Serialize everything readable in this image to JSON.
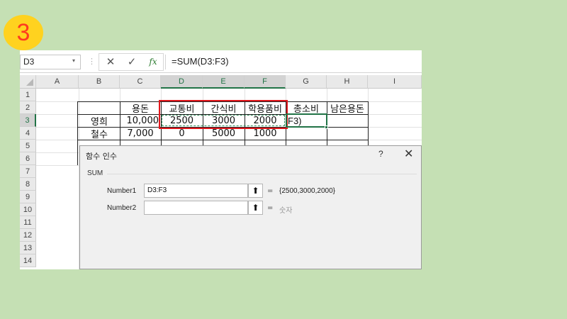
{
  "step_number": "3",
  "namebox": {
    "value": "D3",
    "dropdown_icon": "chevron-down-icon"
  },
  "formula_bar": {
    "cancel_icon": "close-icon",
    "enter_icon": "check-icon",
    "fx_label": "fx",
    "formula": "=SUM(D3:F3)"
  },
  "columns": [
    "A",
    "B",
    "C",
    "D",
    "E",
    "F",
    "G",
    "H",
    "I"
  ],
  "rows": [
    "1",
    "2",
    "3",
    "4",
    "5",
    "6",
    "7",
    "8",
    "9",
    "10",
    "11",
    "12",
    "13",
    "14"
  ],
  "sheet": {
    "header_row": [
      "용돈",
      "교통비",
      "간식비",
      "학용품비",
      "총소비",
      "남은용돈"
    ],
    "data_rows": [
      {
        "name": "영희",
        "values": [
          "10,000",
          "2500",
          "3000",
          "2000",
          "F3)",
          ""
        ]
      },
      {
        "name": "철수",
        "values": [
          "7,000",
          "0",
          "5000",
          "1000",
          "",
          ""
        ]
      }
    ]
  },
  "dialog": {
    "title": "함수 인수",
    "help": "?",
    "close_icon": "close-icon",
    "function_name": "SUM",
    "args": [
      {
        "label": "Number1",
        "value": "D3:F3",
        "eq": "=",
        "result": "{2500,3000,2000}"
      },
      {
        "label": "Number2",
        "value": "",
        "eq": "=",
        "result": "숫자"
      }
    ],
    "collapse_icon": "arrow-up-icon"
  }
}
